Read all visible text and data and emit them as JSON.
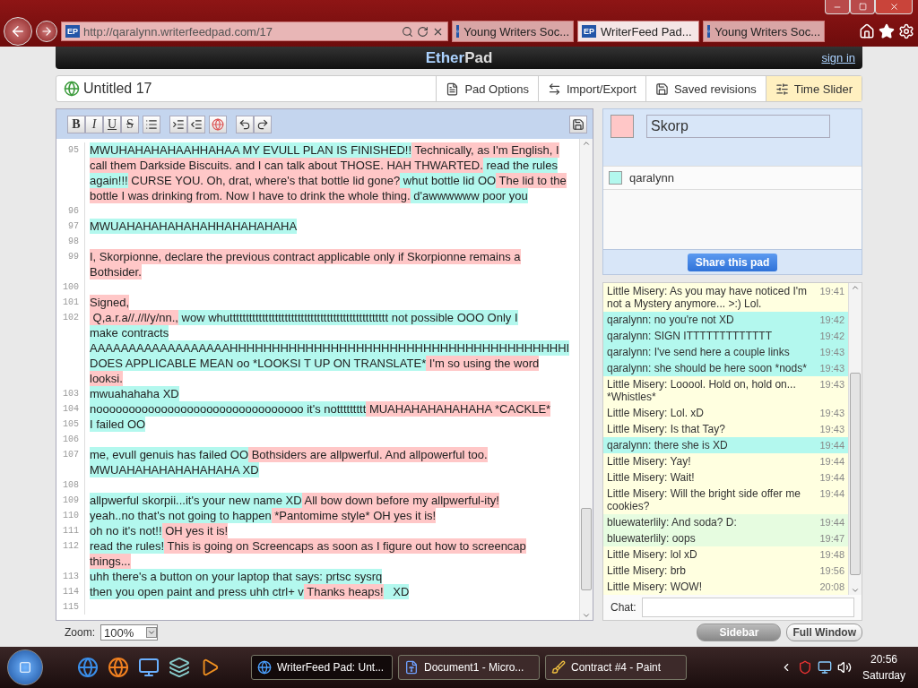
{
  "browser": {
    "url_badge": "EP",
    "url": "http://qaralynn.writerfeedpad.com/17",
    "tabs": [
      {
        "label": "Young Writers Soc...",
        "selected": false,
        "kind": "yws"
      },
      {
        "label": "WriterFeed Pad...",
        "selected": true,
        "kind": "ep",
        "badge": "EP"
      },
      {
        "label": "Young Writers Soc...",
        "selected": false,
        "kind": "yws"
      }
    ]
  },
  "header": {
    "logo_a": "Ether",
    "logo_b": "Pad",
    "sign_in": "sign in"
  },
  "pad_title": "Untitled 17",
  "top_buttons": [
    {
      "label": "Pad Options",
      "kind": "options",
      "selected": false
    },
    {
      "label": "Import/Export",
      "kind": "import",
      "selected": false
    },
    {
      "label": "Saved revisions",
      "kind": "save",
      "selected": false
    },
    {
      "label": "Time Slider",
      "kind": "slider",
      "selected": true
    }
  ],
  "format_buttons": [
    "B",
    "I",
    "U",
    "S"
  ],
  "lines": [
    {
      "number": "95",
      "rows": [
        {
          "segments": [
            {
              "text": "MWUHAHAHAHAAHHAHAA MY EVULL PLAN IS FINISHED!!",
              "color": "#b3f8ee"
            },
            {
              "text": " Technically, as I'm English, I",
              "color": "#ffc7c7"
            }
          ]
        },
        {
          "segments": [
            {
              "text": "call them Darkside Biscuits. and I can talk about THOSE. HAH THWARTED.",
              "color": "#ffc7c7"
            },
            {
              "text": " read the rules",
              "color": "#b3f8ee"
            }
          ]
        },
        {
          "segments": [
            {
              "text": "again!!!",
              "color": "#b3f8ee"
            },
            {
              "text": " CURSE YOU. Oh, drat, where's that bottle lid gone?",
              "color": "#ffc7c7"
            },
            {
              "text": " whut bottle lid OO",
              "color": "#b3f8ee"
            },
            {
              "text": " The lid to the",
              "color": "#ffc7c7"
            }
          ]
        },
        {
          "segments": [
            {
              "text": "bottle I was drinking from. Now I have to drink the whole thing.",
              "color": "#ffc7c7"
            },
            {
              "text": " d'awwwwww poor you",
              "color": "#b3f8ee"
            }
          ]
        }
      ]
    },
    {
      "number": "96"
    },
    {
      "number": "97",
      "rows": [
        {
          "segments": [
            {
              "text": "MWUAHAHAHAHAHAHHAHAHAHAHA",
              "color": "#b3f8ee"
            }
          ]
        }
      ]
    },
    {
      "number": "98"
    },
    {
      "number": "99",
      "rows": [
        {
          "segments": [
            {
              "text": "I, Skorpionne, declare the previous contract applicable only if Skorpionne remains a",
              "color": "#ffc7c7"
            }
          ]
        },
        {
          "segments": [
            {
              "text": "Bothsider.",
              "color": "#ffc7c7"
            }
          ]
        }
      ]
    },
    {
      "number": "100"
    },
    {
      "number": "101",
      "rows": [
        {
          "segments": [
            {
              "text": "Signed,",
              "color": "#ffc7c7"
            }
          ]
        }
      ]
    },
    {
      "number": "102",
      "rows": [
        {
          "segments": [
            {
              "text": " Q,a.r.a//.//l/y/nn.,",
              "color": "#ffc7c7"
            },
            {
              "text": " wow whuttttttttttttttttttttttttttttttttttttttttttttttttt not possible OOO Only I",
              "color": "#b3f8ee"
            }
          ]
        },
        {
          "segments": [
            {
              "text": "make contracts",
              "color": "#b3f8ee"
            }
          ]
        },
        {
          "segments": [
            {
              "text": "AAAAAAAAAAAAAAAAAAHHHHHHHHHHHHHHHHHHHHHHHHHHHHHHHHHHHHHHHHI",
              "color": "#b3f8ee"
            }
          ]
        },
        {
          "segments": [
            {
              "text": "DOES APPLICABLE MEAN oo *LOOKSI T UP ON TRANSLATE*",
              "color": "#b3f8ee"
            },
            {
              "text": " I'm so using the word",
              "color": "#ffc7c7"
            }
          ]
        },
        {
          "segments": [
            {
              "text": "looksi.",
              "color": "#ffc7c7"
            }
          ]
        }
      ]
    },
    {
      "number": "103",
      "rows": [
        {
          "segments": [
            {
              "text": "mwuahahaha XD",
              "color": "#b3f8ee"
            }
          ]
        }
      ]
    },
    {
      "number": "104",
      "rows": [
        {
          "segments": [
            {
              "text": "noooooooooooooooooooooooooooooooo it's nottttttttt",
              "color": "#b3f8ee"
            },
            {
              "text": " MUAHAHAHAHAHAHA *CACKLE*",
              "color": "#ffc7c7"
            }
          ]
        }
      ]
    },
    {
      "number": "105",
      "rows": [
        {
          "segments": [
            {
              "text": "I failed OO",
              "color": "#b3f8ee"
            }
          ]
        }
      ]
    },
    {
      "number": "106"
    },
    {
      "number": "107",
      "rows": [
        {
          "segments": [
            {
              "text": "me, evull genuis has failed OO",
              "color": "#b3f8ee"
            },
            {
              "text": " Bothsiders are allpwerful. And allpowerful too.",
              "color": "#ffc7c7"
            }
          ]
        },
        {
          "segments": [
            {
              "text": "MWUAHAHAHAHAHAHAHA XD",
              "color": "#b3f8ee"
            }
          ]
        }
      ]
    },
    {
      "number": "108"
    },
    {
      "number": "109",
      "rows": [
        {
          "segments": [
            {
              "text": "allpwerful skorpii...it's your new name XD",
              "color": "#b3f8ee"
            },
            {
              "text": " All bow down before my allpwerful-ity!",
              "color": "#ffc7c7"
            }
          ]
        }
      ]
    },
    {
      "number": "110",
      "rows": [
        {
          "segments": [
            {
              "text": "yeah..no that's not going to happen",
              "color": "#b3f8ee"
            },
            {
              "text": " *Pantomime style* OH yes it is!",
              "color": "#ffc7c7"
            }
          ]
        }
      ]
    },
    {
      "number": "111",
      "rows": [
        {
          "segments": [
            {
              "text": "oh no it's not!!",
              "color": "#b3f8ee"
            },
            {
              "text": " OH yes it is!",
              "color": "#ffc7c7"
            }
          ]
        }
      ]
    },
    {
      "number": "112",
      "rows": [
        {
          "segments": [
            {
              "text": "read the rules!",
              "color": "#b3f8ee"
            },
            {
              "text": " This is going on Screencaps as soon as I figure out how to screencap",
              "color": "#ffc7c7"
            }
          ]
        },
        {
          "segments": [
            {
              "text": "things...",
              "color": "#ffc7c7"
            }
          ]
        }
      ]
    },
    {
      "number": "113",
      "rows": [
        {
          "segments": [
            {
              "text": "uhh there's a button on your laptop that says: prtsc sysrq",
              "color": "#b3f8ee"
            }
          ]
        }
      ]
    },
    {
      "number": "114",
      "rows": [
        {
          "segments": [
            {
              "text": "then you open paint and press uhh ctrl+ v",
              "color": "#b3f8ee"
            },
            {
              "text": " Thanks heaps!",
              "color": "#ffc7c7"
            },
            {
              "text": "   XD",
              "color": "#b3f8ee"
            }
          ]
        }
      ]
    },
    {
      "number": "115"
    }
  ],
  "zoom": {
    "label": "Zoom:",
    "value": "100%"
  },
  "users": {
    "me": {
      "name": "Skorp",
      "color": "#ffc7c7"
    },
    "others": [
      {
        "name": "qaralynn",
        "color": "#b3f8ee"
      }
    ],
    "share": "Share this pad"
  },
  "chat": {
    "messages": [
      {
        "text": "Little Misery: As you may have noticed I'm not a Mystery anymore... >:) Lol.",
        "time": "19:41",
        "color": "#ffffe0"
      },
      {
        "text": "qaralynn: no you're not XD",
        "time": "19:42",
        "color": "#b3f8ee"
      },
      {
        "text": "qaralynn: SIGN ITTTTTTTTTTTTT",
        "time": "19:42",
        "color": "#b3f8ee"
      },
      {
        "text": "qaralynn: I've send here a couple links",
        "time": "19:43",
        "color": "#b3f8ee"
      },
      {
        "text": "qaralynn: she should be here soon *nods*",
        "time": "19:43",
        "color": "#b3f8ee"
      },
      {
        "text": "Little Misery: Looool. Hold on, hold on... *Whistles*",
        "time": "19:43",
        "color": "#ffffe0"
      },
      {
        "text": "Little Misery: Lol. xD",
        "time": "19:43",
        "color": "#ffffe0"
      },
      {
        "text": "Little Misery: Is that Tay?",
        "time": "19:43",
        "color": "#ffffe0"
      },
      {
        "text": "qaralynn: there she is XD",
        "time": "19:44",
        "color": "#b3f8ee"
      },
      {
        "text": "Little Misery: Yay!",
        "time": "19:44",
        "color": "#ffffe0"
      },
      {
        "text": "Little Misery: Wait!",
        "time": "19:44",
        "color": "#ffffe0"
      },
      {
        "text": "Little Misery: Will the bright side offer me cookies?",
        "time": "19:44",
        "color": "#ffffe0"
      },
      {
        "text": "bluewaterlily: And soda? D:",
        "time": "19:44",
        "color": "#e6fce0"
      },
      {
        "text": "bluewaterlily: oops",
        "time": "19:47",
        "color": "#e6fce0"
      },
      {
        "text": "Little Misery: lol xD",
        "time": "19:48",
        "color": "#ffffe0"
      },
      {
        "text": "Little Misery: brb",
        "time": "19:56",
        "color": "#ffffe0"
      },
      {
        "text": "Little Misery: WOW!",
        "time": "20:08",
        "color": "#ffffe0"
      }
    ],
    "label": "Chat:"
  },
  "view_buttons": [
    {
      "label": "Sidebar",
      "selected": true
    },
    {
      "label": "Full Window",
      "selected": false
    }
  ],
  "taskbar": {
    "tasks": [
      {
        "label": "WriterFeed Pad: Unt...",
        "kind": "ie",
        "selected": true
      },
      {
        "label": "Document1 - Micro...",
        "kind": "word",
        "selected": false
      },
      {
        "label": "Contract #4 - Paint",
        "kind": "paint",
        "selected": false
      }
    ],
    "time": "20:56",
    "day": "Saturday"
  }
}
